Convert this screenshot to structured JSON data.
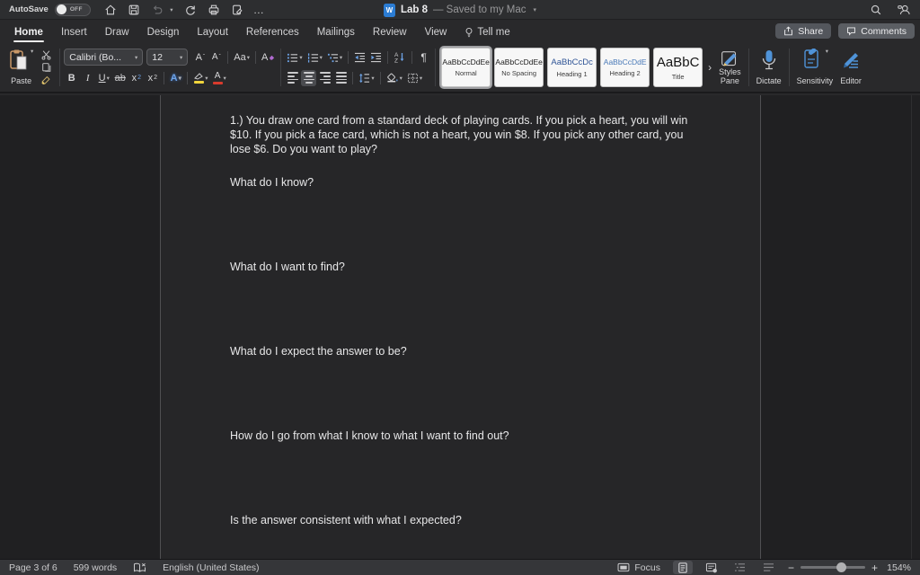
{
  "titlebar": {
    "autosave_label": "AutoSave",
    "autosave_state": "OFF",
    "doc_title": "Lab 8",
    "doc_status": "— Saved to my Mac"
  },
  "tabs": [
    {
      "label": "Home"
    },
    {
      "label": "Insert"
    },
    {
      "label": "Draw"
    },
    {
      "label": "Design"
    },
    {
      "label": "Layout"
    },
    {
      "label": "References"
    },
    {
      "label": "Mailings"
    },
    {
      "label": "Review"
    },
    {
      "label": "View"
    },
    {
      "label": "Tell me"
    }
  ],
  "actions": {
    "share_label": "Share",
    "comments_label": "Comments"
  },
  "ribbon": {
    "paste_label": "Paste",
    "font_name": "Calibri (Bo...",
    "font_size": "12",
    "buttons": {
      "grow": "A",
      "shrink": "A",
      "case": "Aa",
      "clear": "A",
      "bold": "B",
      "italic": "I",
      "underline": "U",
      "strike": "ab",
      "sub_base": "x",
      "sub_mark": "2",
      "sup_base": "x",
      "sup_mark": "2",
      "effects": "A",
      "font_color": "A"
    },
    "styles_gallery": [
      {
        "sample": "AaBbCcDdEe",
        "name": "Normal"
      },
      {
        "sample": "AaBbCcDdEe",
        "name": "No Spacing"
      },
      {
        "sample": "AaBbCcDc",
        "name": "Heading 1"
      },
      {
        "sample": "AaBbCcDdE",
        "name": "Heading 2"
      },
      {
        "sample": "AaBbC",
        "name": "Title"
      }
    ],
    "styles_pane_label": "Styles\nPane",
    "dictate_label": "Dictate",
    "sensitivity_label": "Sensitivity",
    "editor_label": "Editor"
  },
  "icons": {
    "ellipsis": "…",
    "dropdown": "▾",
    "title_chevron": "▾",
    "gallery_more": "›",
    "pilcrow": "¶",
    "zoom_out": "−",
    "zoom_in": "+"
  },
  "document": {
    "paragraph": "1.) You draw one card from a standard deck of playing cards. If you pick a heart, you will win $10. If you pick a face card, which is not a heart, you win $8. If you pick any other card, you lose $6. Do you want to play?",
    "questions": [
      "What do I know?",
      "What do I want to find?",
      "What do I expect the answer to be?",
      "How do I go from what I know to what I want to find out?",
      "Is the answer consistent with what I expected?"
    ]
  },
  "statusbar": {
    "page_info": "Page 3 of 6",
    "word_count": "599 words",
    "language": "English (United States)",
    "focus_label": "Focus",
    "zoom_level": "154%"
  },
  "colors": {
    "accent_blue": "#4f93d8",
    "heading_blue": "#2f5496",
    "highlight_yellow": "#f0d43c",
    "font_red": "#d83b2d",
    "clipboard_tan": "#c99767"
  }
}
